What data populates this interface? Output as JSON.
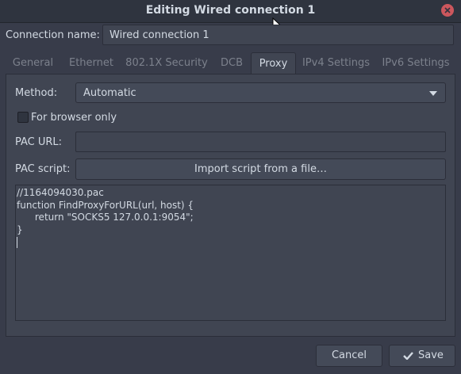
{
  "window": {
    "title": "Editing Wired connection 1"
  },
  "connection": {
    "label": "Connection name:",
    "value": "Wired connection 1"
  },
  "tabs": [
    {
      "label": "General",
      "active": false
    },
    {
      "label": "Ethernet",
      "active": false
    },
    {
      "label": "802.1X Security",
      "active": false
    },
    {
      "label": "DCB",
      "active": false
    },
    {
      "label": "Proxy",
      "active": true
    },
    {
      "label": "IPv4 Settings",
      "active": false
    },
    {
      "label": "IPv6 Settings",
      "active": false
    }
  ],
  "proxy": {
    "method_label": "Method:",
    "method_value": "Automatic",
    "browser_only_label": "For browser only",
    "browser_only_checked": false,
    "pac_url_label": "PAC URL:",
    "pac_url_value": "",
    "pac_script_label": "PAC script:",
    "import_button": "Import script from a file…",
    "script_lines": [
      "//1164094030.pac",
      "function FindProxyForURL(url, host) {",
      "      return \"SOCKS5 127.0.0.1:9054\";",
      "}"
    ]
  },
  "buttons": {
    "cancel": "Cancel",
    "save": "Save"
  },
  "icons": {
    "close": "close-icon",
    "caret": "chevron-down-icon",
    "save": "checkmark-icon"
  },
  "colors": {
    "background": "#383c4a",
    "close": "#cc575d",
    "text": "#d3dae3"
  }
}
